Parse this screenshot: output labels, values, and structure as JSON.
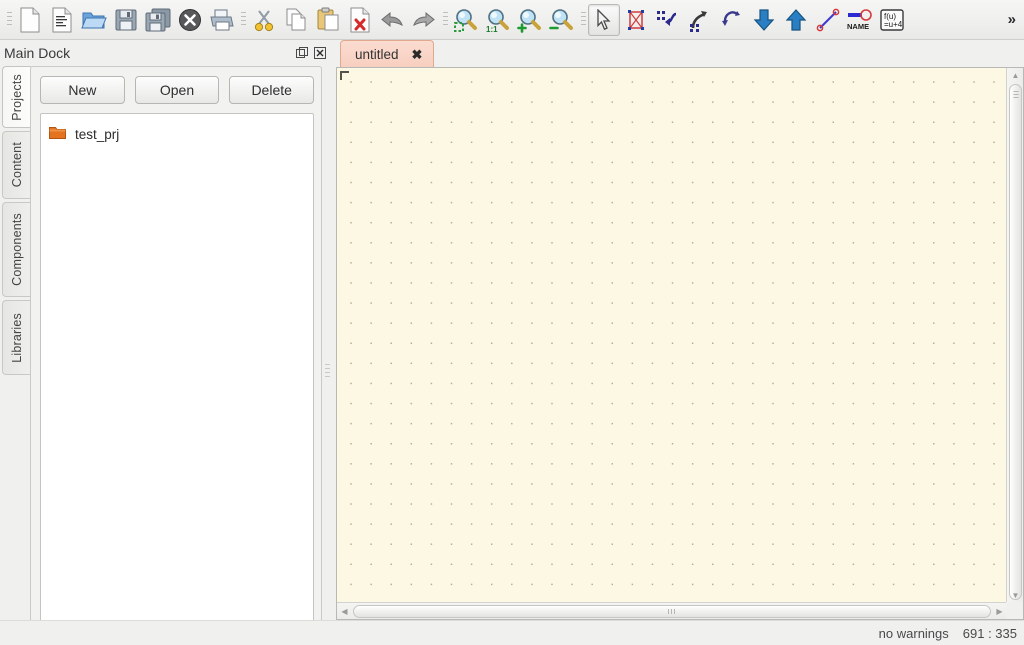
{
  "toolbar": {
    "items": [
      {
        "name": "new-file-icon",
        "label": "New"
      },
      {
        "name": "new-from-template-icon",
        "label": "New from template"
      },
      {
        "name": "open-folder-icon",
        "label": "Open"
      },
      {
        "name": "save-icon",
        "label": "Save"
      },
      {
        "name": "save-all-icon",
        "label": "Save All"
      },
      {
        "name": "close-icon",
        "label": "Close"
      },
      {
        "name": "print-icon",
        "label": "Print"
      },
      {
        "name": "cut-icon",
        "label": "Cut"
      },
      {
        "name": "copy-icon",
        "label": "Copy"
      },
      {
        "name": "paste-icon",
        "label": "Paste"
      },
      {
        "name": "delete-icon",
        "label": "Delete"
      },
      {
        "name": "undo-icon",
        "label": "Undo"
      },
      {
        "name": "redo-icon",
        "label": "Redo"
      },
      {
        "name": "zoom-fit-icon",
        "label": "Zoom to fit"
      },
      {
        "name": "zoom-actual-icon",
        "label": "Zoom 1:1"
      },
      {
        "name": "zoom-in-icon",
        "label": "Zoom in"
      },
      {
        "name": "zoom-out-icon",
        "label": "Zoom out"
      },
      {
        "name": "select-tool-icon",
        "label": "Select"
      },
      {
        "name": "component-icon",
        "label": "Insert component"
      },
      {
        "name": "wire-route-icon",
        "label": "Wire"
      },
      {
        "name": "bus-route-icon",
        "label": "Bus"
      },
      {
        "name": "rotate-icon",
        "label": "Rotate"
      },
      {
        "name": "port-in-icon",
        "label": "Input port"
      },
      {
        "name": "port-out-icon",
        "label": "Output port"
      },
      {
        "name": "line-icon",
        "label": "Line"
      },
      {
        "name": "net-name-icon",
        "label": "NAME"
      },
      {
        "name": "formula-icon",
        "label": "f(u)=u+4"
      }
    ],
    "formula_top": "f(u)",
    "formula_bottom": "=u+4",
    "net_label": "NAME",
    "overflow": "»"
  },
  "dock": {
    "title": "Main Dock",
    "float_button": "float-dock",
    "close_button": "close-dock",
    "tabs": [
      {
        "label": "Projects",
        "selected": true
      },
      {
        "label": "Content",
        "selected": false
      },
      {
        "label": "Components",
        "selected": false
      },
      {
        "label": "Libraries",
        "selected": false
      }
    ],
    "buttons": [
      {
        "label": "New"
      },
      {
        "label": "Open"
      },
      {
        "label": "Delete"
      }
    ],
    "projects": [
      {
        "label": "test_prj",
        "icon": "folder-icon"
      }
    ]
  },
  "editor": {
    "tabs": [
      {
        "label": "untitled",
        "close": "✖",
        "active": true
      }
    ],
    "canvas": {
      "background_color": "#fcf8e3",
      "grid_color": "#b9ae8c",
      "grid_spacing": 20
    },
    "scrollbars": {
      "up": "▲",
      "down": "▼",
      "left": "◀",
      "right": "▶"
    }
  },
  "statusbar": {
    "warnings": "no warnings",
    "coordinates": "691 : 335"
  }
}
